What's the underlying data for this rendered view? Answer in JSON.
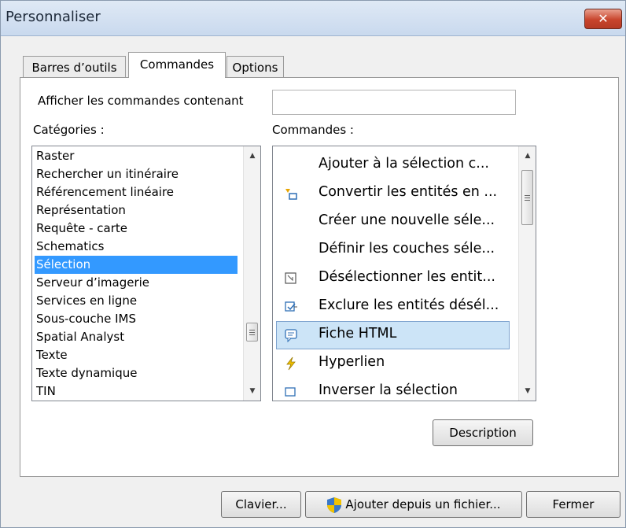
{
  "window": {
    "title": "Personnaliser",
    "close_glyph": "✕"
  },
  "tabs": [
    {
      "label": "Barres d’outils",
      "active": false
    },
    {
      "label": "Commandes",
      "active": true
    },
    {
      "label": "Options",
      "active": false
    }
  ],
  "search": {
    "label": "Afficher les commandes contenant",
    "value": ""
  },
  "categories": {
    "label": "Catégories :",
    "selected": "Sélection",
    "items": [
      "Raster",
      "Rechercher un itinéraire",
      "Référencement linéaire",
      "Représentation",
      "Requête - carte",
      "Schematics",
      "Sélection",
      "Serveur d’imagerie",
      "Services en ligne",
      "Sous-couche IMS",
      "Spatial Analyst",
      "Texte",
      "Texte dynamique",
      "TIN"
    ]
  },
  "commands": {
    "label": "Commandes :",
    "selected": "Fiche HTML",
    "items": [
      {
        "label": "Ajouter à la sélection c...",
        "icon": ""
      },
      {
        "label": "Convertir les entités en ...",
        "icon": "convert-features-icon"
      },
      {
        "label": "Créer une nouvelle séle...",
        "icon": ""
      },
      {
        "label": "Définir les couches séle...",
        "icon": ""
      },
      {
        "label": "Désélectionner les entit...",
        "icon": "clear-selection-icon"
      },
      {
        "label": "Exclure les entités désél...",
        "icon": "switch-selection-icon"
      },
      {
        "label": "Fiche HTML",
        "icon": "html-popup-icon"
      },
      {
        "label": "Hyperlien",
        "icon": "hyperlink-lightning-icon"
      },
      {
        "label": "Inverser la sélection",
        "icon": "invert-selection-icon"
      }
    ]
  },
  "buttons": {
    "description": "Description",
    "keyboard": "Clavier...",
    "add_from_file": "Ajouter depuis un fichier...",
    "close": "Fermer"
  },
  "colors": {
    "selection": "#3399ff",
    "command_selection": "#cce4f7",
    "close_button": "#c8442c"
  }
}
